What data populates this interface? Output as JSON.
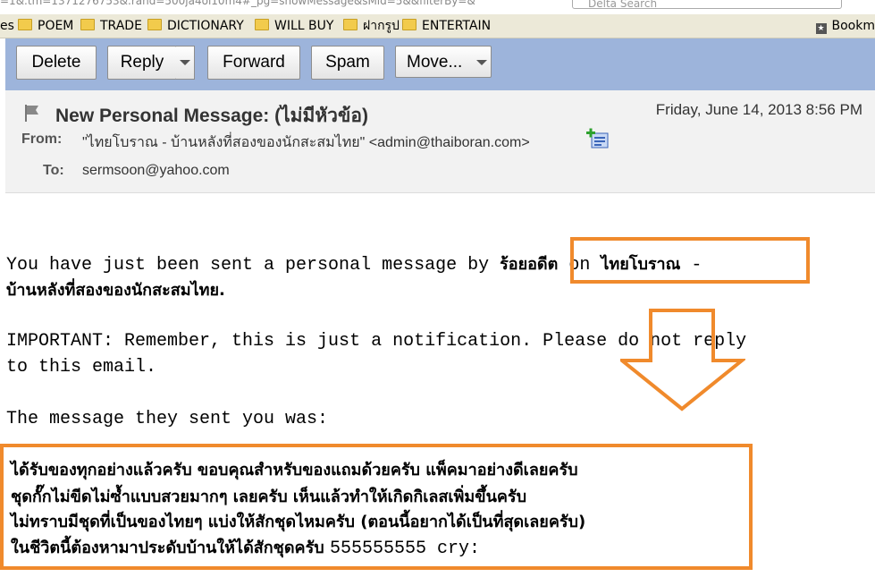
{
  "browser": {
    "url_fragment": "=1&.tm=1371276753&.rand=500ja4oi10m4#_pg=showMessage&sMid=5&&filterBy=&",
    "search_placeholder": "Delta Search"
  },
  "bookmarks": {
    "items": [
      {
        "label": "es"
      },
      {
        "label": "POEM"
      },
      {
        "label": "TRADE"
      },
      {
        "label": "DICTIONARY"
      },
      {
        "label": "WILL BUY"
      },
      {
        "label": "ฝากรูป"
      },
      {
        "label": "ENTERTAIN"
      }
    ],
    "right_label": "Bookm"
  },
  "toolbar": {
    "delete_label": "Delete",
    "reply_label": "Reply",
    "forward_label": "Forward",
    "spam_label": "Spam",
    "move_label": "Move..."
  },
  "header": {
    "subject": "New Personal Message: (ไม่มีหัวข้อ)",
    "date": "Friday, June 14, 2013 8:56 PM",
    "from_label": "From:",
    "from_value": "\"ไทยโบราณ - บ้านหลังที่สองของนักสะสมไทย\" <admin@thaiboran.com>",
    "to_label": "To:",
    "to_value": "sermsoon@yahoo.com"
  },
  "body": {
    "line1_prefix": "You have just been sent a personal message by ",
    "line1_sender": "ร้อยอดีต",
    "line1_on": " on ",
    "line1_site": "ไทยโบราณ",
    "line1_suffix": " -",
    "line2": "บ้านหลังที่สองของนักสะสมไทย.",
    "line3": "IMPORTANT: Remember, this is just a notification. Please do not reply",
    "line4": "to this email.",
    "line5": "The message they sent you was:",
    "msg_line1": "ได้รับของทุกอย่างแล้วครับ  ขอบคุณสำหรับของแถมด้วยครับ  แพ็คมาอย่างดีเลยครับ",
    "msg_line2": "ชุดกั๊กไม่ขีดไม่ซ้ำแบบสวยมากๆ  เลยครับ  เห็นแล้วทำให้เกิดกิเลสเพิ่มขึ้นครับ",
    "msg_line3": "ไม่ทราบมีชุดที่เป็นของไทยๆ  แบ่งให้สักชุดไหมครับ (ตอนนี้อยากได้เป็นที่สุดเลยครับ)",
    "msg_line4_thai": "ในชีวิตนี้ต้องหามาประดับบ้านให้ได้สักชุดครับ ",
    "msg_line4_mono": "555555555 cry:"
  },
  "colors": {
    "toolbar_bg": "#9db4db",
    "annotation_orange": "#f08a2c",
    "header_bg": "#f2f2f2"
  }
}
